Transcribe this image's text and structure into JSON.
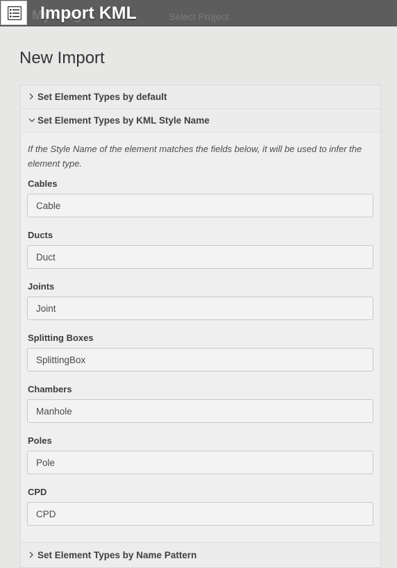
{
  "header": {
    "title": "Import KML",
    "background_title": "MyKing",
    "project_selector": "Select Project"
  },
  "page": {
    "heading": "New Import"
  },
  "accordion": {
    "sections": [
      {
        "label": "Set Element Types by default",
        "expanded": false
      },
      {
        "label": "Set Element Types by KML Style Name",
        "expanded": true
      },
      {
        "label": "Set Element Types by Name Pattern",
        "expanded": false
      }
    ],
    "help_text": "If the Style Name of the element matches the fields below, it will be used to infer the element type.",
    "fields": [
      {
        "label": "Cables",
        "value": "Cable"
      },
      {
        "label": "Ducts",
        "value": "Duct"
      },
      {
        "label": "Joints",
        "value": "Joint"
      },
      {
        "label": "Splitting Boxes",
        "value": "SplittingBox"
      },
      {
        "label": "Chambers",
        "value": "Manhole"
      },
      {
        "label": "Poles",
        "value": "Pole"
      },
      {
        "label": "CPD",
        "value": "CPD"
      }
    ]
  },
  "colors": {
    "topbar": "#5d5d5d",
    "page_background": "#e7e7e6",
    "title_text": "#ffffff"
  },
  "icons": {
    "app": "list-icon",
    "collapsed": "chevron-right-icon",
    "expanded": "chevron-down-icon"
  }
}
